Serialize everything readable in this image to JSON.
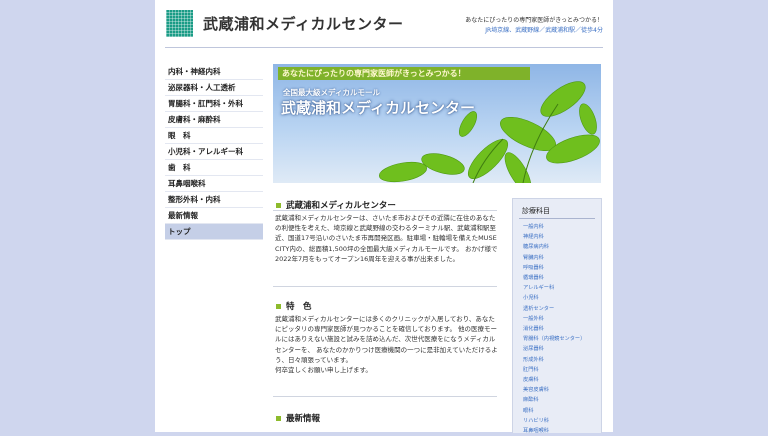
{
  "header": {
    "site_title": "武蔵浦和メディカルセンター",
    "tagline": "あなたにぴったりの専門家医師がきっとみつかる！",
    "access": "JR埼京線、武蔵野線／武蔵浦和駅／徒歩4分"
  },
  "nav": {
    "items": [
      {
        "label": "内科・神経内科"
      },
      {
        "label": "泌尿器科・人工透析"
      },
      {
        "label": "胃腸科・肛門科・外科"
      },
      {
        "label": "皮膚科・麻酔科"
      },
      {
        "label": "眼　科"
      },
      {
        "label": "小児科・アレルギー科"
      },
      {
        "label": "歯　科"
      },
      {
        "label": "耳鼻咽喉科"
      },
      {
        "label": "整形外科・内科"
      },
      {
        "label": "最新情報"
      },
      {
        "label": "トップ"
      }
    ],
    "active_index": 10
  },
  "hero": {
    "catch": "あなたにぴったりの専門家医師がきっとみつかる！",
    "sub": "全国最大級メディカルモール",
    "title": "武蔵浦和メディカルセンター"
  },
  "main": {
    "intro_heading": "武蔵浦和メディカルセンター",
    "intro_text": "武蔵浦和メディカルセンターは、さいたま市およびその近隣に在住のあなたの利便性を考えた、埼京線と武蔵野線の交わるターミナル駅、武蔵浦和駅至近、国道17号沿いのさいたま市再開発区画。駐車場・駐輪場を備えたMUSE CITY内の、総面積1,500坪の全国最大級メディカルモールです。 おかげ様で2022年7月をもってオープン16周年を迎える事が出来ました。",
    "feature_heading": "特　色",
    "feature_text": "武蔵浦和メディカルセンターには多くのクリニックが入居しており、あなたにピッタリの専門家医師が見つかることを確信しております。 他の医療モールにはありえない施設と試みを詰め込んだ、次世代医療をになうメディカルセンターを、 あなたのかかりつけ医療機関の一つに是非加えていただけるよう、日々頑張っています。",
    "feature_closing": "何卒宜しくお願い申し上げます。",
    "news_heading": "最新情報"
  },
  "sidebar": {
    "title": "診療科目",
    "items": [
      "一般内科",
      "神経内科",
      "糖尿病内科",
      "腎臓内科",
      "呼吸器科",
      "循環器科",
      "アレルギー科",
      "小児科",
      "透析センター",
      "一般外科",
      "消化器科",
      "胃腸科（内視鏡センター）",
      "泌尿器科",
      "形成外科",
      "肛門科",
      "皮膚科",
      "美容皮膚科",
      "麻酔科",
      "眼科",
      "リハビリ科",
      "耳鼻咽喉科"
    ]
  },
  "colors": {
    "page_bg": "#cfd6ee",
    "accent_green": "#8dbb2c",
    "link_blue": "#3a6fc4",
    "logo_teal": "#1a9c86"
  }
}
